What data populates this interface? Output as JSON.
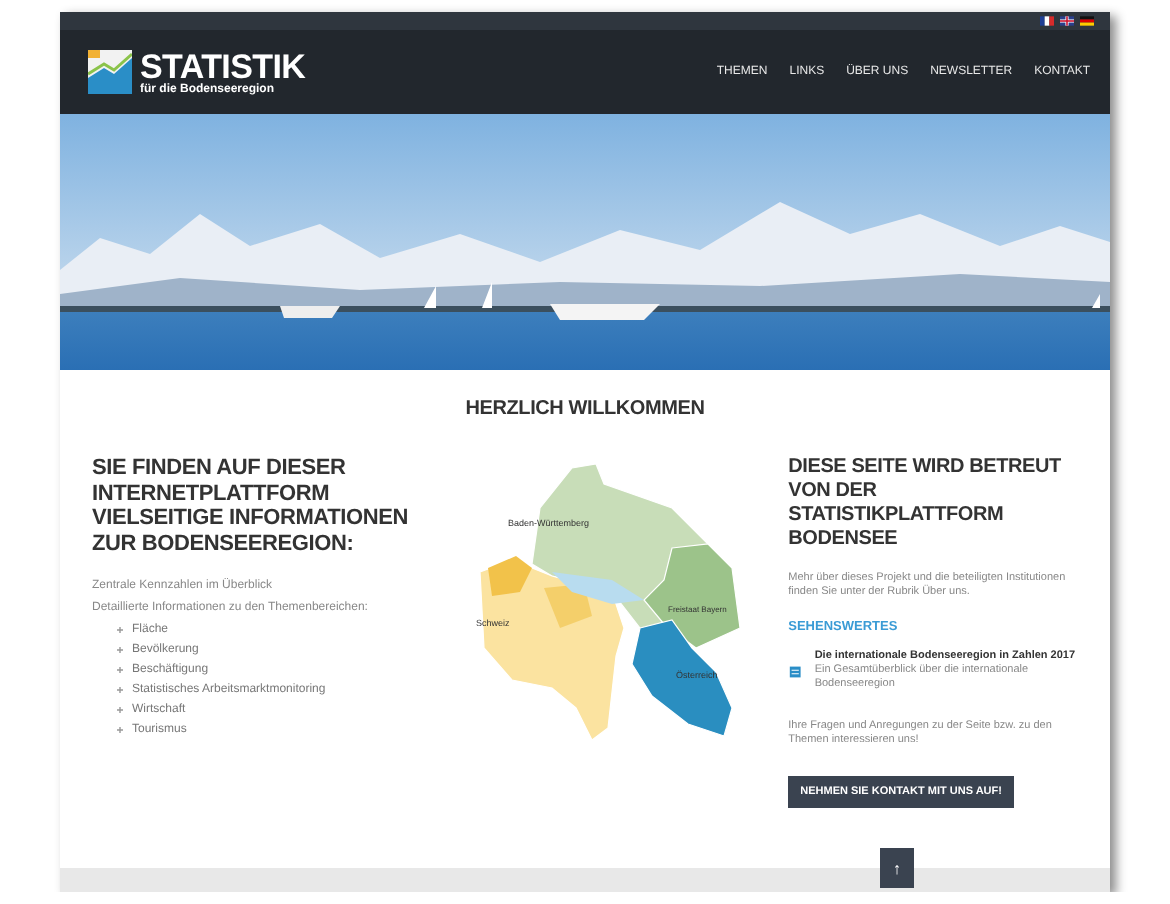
{
  "header": {
    "logo_title": "STATISTIK",
    "logo_subtitle": "für die Bodenseeregion",
    "nav": [
      "THEMEN",
      "LINKS",
      "ÜBER UNS",
      "NEWSLETTER",
      "KONTAKT"
    ]
  },
  "welcome": {
    "heading": "HERZLICH WILLKOMMEN"
  },
  "left": {
    "heading": "SIE FINDEN AUF DIESER INTERNETPLATTFORM VIELSEITIGE INFORMATIONEN ZUR BODENSEEREGION:",
    "paragraphs": [
      "Zentrale Kennzahlen im Überblick",
      "Detaillierte Informationen zu den Themenbereichen:"
    ],
    "topics": [
      "Fläche",
      "Bevölkerung",
      "Beschäftigung",
      "Statistisches Arbeitsmarktmonitoring",
      "Wirtschaft",
      "Tourismus"
    ]
  },
  "map": {
    "labels": [
      "Baden-Württemberg",
      "Schweiz",
      "Freistaat Bayern",
      "Österreich"
    ]
  },
  "right": {
    "heading": "DIESE SEITE WIRD BETREUT VON DER STATISTIKPLATTFORM BODENSEE",
    "intro": "Mehr über dieses Projekt und die beteiligten Institutionen finden Sie unter der Rubrik Über uns.",
    "section_title": "SEHENSWERTES",
    "item": {
      "title": "Die internationale Bodenseeregion in Zahlen 2017",
      "description": "Ein Gesamtüberblick über die internationale Bodenseeregion"
    },
    "contact_text": "Ihre Fragen und Anregungen zu der Seite bzw. zu den Themen interessieren uns!",
    "contact_button": "NEHMEN SIE KONTAKT MIT UNS AUF!"
  },
  "back_to_top": "↑"
}
